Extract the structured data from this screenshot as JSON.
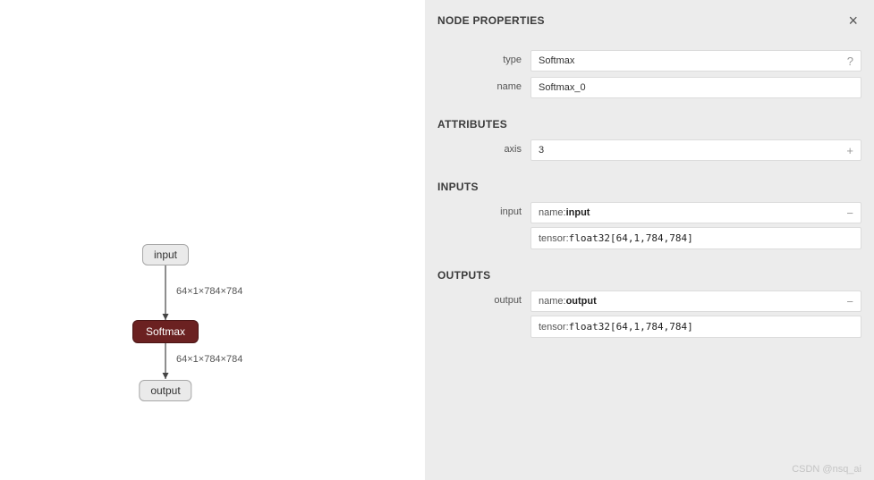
{
  "graph": {
    "input_label": "input",
    "op_label": "Softmax",
    "output_label": "output",
    "edge1_shape": "64×1×784×784",
    "edge2_shape": "64×1×784×784"
  },
  "panel": {
    "title": "NODE PROPERTIES",
    "fields": {
      "type_label": "type",
      "type_value": "Softmax",
      "name_label": "name",
      "name_value": "Softmax_0"
    },
    "attributes": {
      "heading": "ATTRIBUTES",
      "axis_label": "axis",
      "axis_value": "3"
    },
    "inputs": {
      "heading": "INPUTS",
      "row_label": "input",
      "name_key": "name: ",
      "name_value": "input",
      "tensor_key": "tensor: ",
      "tensor_value": "float32[64,1,784,784]"
    },
    "outputs": {
      "heading": "OUTPUTS",
      "row_label": "output",
      "name_key": "name: ",
      "name_value": "output",
      "tensor_key": "tensor: ",
      "tensor_value": "float32[64,1,784,784]"
    }
  },
  "glyphs": {
    "close": "×",
    "help": "?",
    "plus": "+",
    "minus": "−"
  },
  "watermark": "CSDN @nsq_ai"
}
